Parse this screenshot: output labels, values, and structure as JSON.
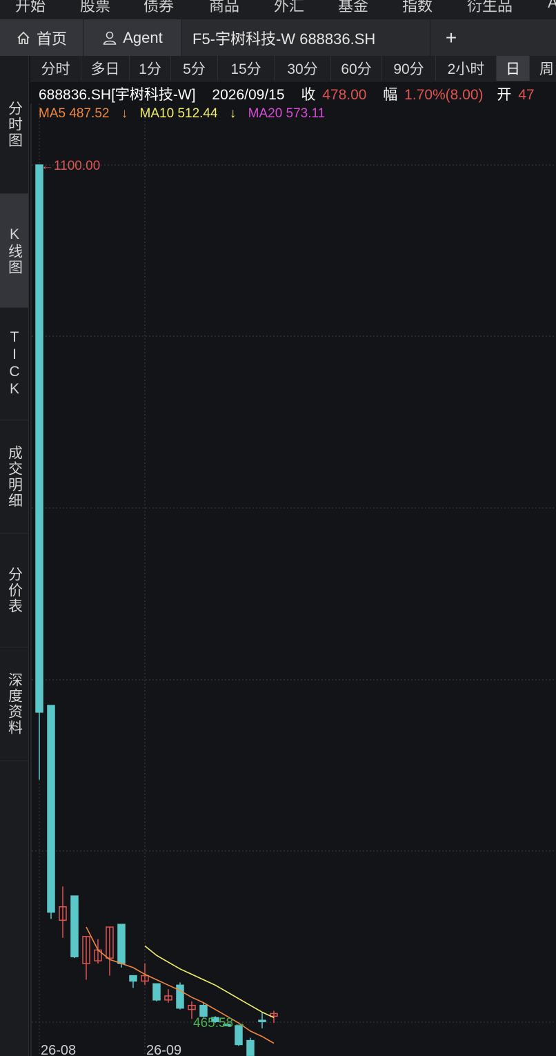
{
  "top_nav": [
    "开始",
    "股票",
    "债券",
    "商品",
    "外汇",
    "基金",
    "指数",
    "衍生品",
    "A"
  ],
  "tabs": {
    "home": "首页",
    "agent": "Agent",
    "stock": "F5-宇树科技-W 688836.SH",
    "add": "+"
  },
  "sidebar": [
    "分时图",
    "K线图",
    "TICK",
    "成交明细",
    "分价表",
    "深度资料"
  ],
  "periods": [
    "分时",
    "多日",
    "1分",
    "5分",
    "15分",
    "30分",
    "60分",
    "90分",
    "2小时",
    "日",
    "周"
  ],
  "info": {
    "code_name": "688836.SH[宇树科技-W]",
    "date": "2026/09/15",
    "close_label": "收",
    "close_value": "478.00",
    "change_label": "幅",
    "change_value": "1.70%(8.00)",
    "open_label": "开",
    "open_value": "47"
  },
  "ma": {
    "ma5_label": "MA5 487.52",
    "ma5_arrow": "↓",
    "ma10_label": "MA10 512.44",
    "ma10_arrow": "↓",
    "ma20_label": "MA20 573.11"
  },
  "colors": {
    "up": "#e05552",
    "down": "#5bc7c9",
    "ma5": "#f0883e",
    "ma10": "#f4f06a",
    "ma20": "#d84ad8",
    "high_label": "#e05552",
    "low_label": "#4caf50"
  },
  "chart_data": {
    "type": "candlestick",
    "y_range": [
      465.58,
      1100.0
    ],
    "high_label": "←1100.00",
    "low_label": "465.58→",
    "x_labels": [
      {
        "text": "26-08",
        "index": 0
      },
      {
        "text": "26-09",
        "index": 9
      }
    ],
    "candles": [
      {
        "open": 1100.0,
        "high": 1100.0,
        "low": 645.0,
        "close": 695.0
      },
      {
        "open": 700.0,
        "high": 700.0,
        "low": 542.0,
        "close": 547.0
      },
      {
        "open": 541.0,
        "high": 566.0,
        "low": 528.0,
        "close": 551.0
      },
      {
        "open": 559.0,
        "high": 559.0,
        "low": 513.0,
        "close": 514.0
      },
      {
        "open": 509.0,
        "high": 522.0,
        "low": 497.0,
        "close": 529.0
      },
      {
        "open": 511.0,
        "high": 527.0,
        "low": 509.0,
        "close": 519.0
      },
      {
        "open": 513.0,
        "high": 530.0,
        "low": 500.0,
        "close": 536.0
      },
      {
        "open": 538.0,
        "high": 538.0,
        "low": 506.0,
        "close": 509.0
      },
      {
        "open": 500.0,
        "high": 500.0,
        "low": 491.0,
        "close": 496.0
      },
      {
        "open": 496.0,
        "high": 509.0,
        "low": 493.0,
        "close": 500.0
      },
      {
        "open": 494.0,
        "high": 494.0,
        "low": 481.0,
        "close": 482.0
      },
      {
        "open": 482.0,
        "high": 490.0,
        "low": 480.0,
        "close": 485.0
      },
      {
        "open": 493.0,
        "high": 495.0,
        "low": 475.0,
        "close": 476.0
      },
      {
        "open": 475.0,
        "high": 481.0,
        "low": 468.0,
        "close": 478.0
      },
      {
        "open": 478.0,
        "high": 480.0,
        "low": 469.0,
        "close": 470.0
      },
      {
        "open": 469.0,
        "high": 470.0,
        "low": 465.0,
        "close": 466.0
      },
      {
        "open": 464.0,
        "high": 464.0,
        "low": 463.0,
        "close": 463.0
      },
      {
        "open": 463.0,
        "high": 455.0,
        "low": 448.0,
        "close": 449.0
      },
      {
        "open": 452.0,
        "high": 454.0,
        "low": 441.0,
        "close": 441.0
      },
      {
        "open": 467.0,
        "high": 473.0,
        "low": 461.0,
        "close": 466.0
      },
      {
        "open": 470.0,
        "high": 474.0,
        "low": 465.0,
        "close": 472.0
      }
    ],
    "ma5": [
      null,
      null,
      null,
      null,
      536.0,
      519.0,
      512.0,
      509.0,
      506.0,
      501.0,
      497.0,
      493.0,
      489.0,
      484.0,
      480.0,
      475.0,
      470.0,
      465.0,
      459.0,
      455.0,
      450.0
    ],
    "ma10": [
      null,
      null,
      null,
      null,
      null,
      null,
      null,
      null,
      null,
      522.0,
      515.0,
      510.0,
      505.0,
      501.0,
      497.0,
      493.0,
      488.0,
      483.0,
      478.0,
      473.0,
      469.0
    ]
  }
}
